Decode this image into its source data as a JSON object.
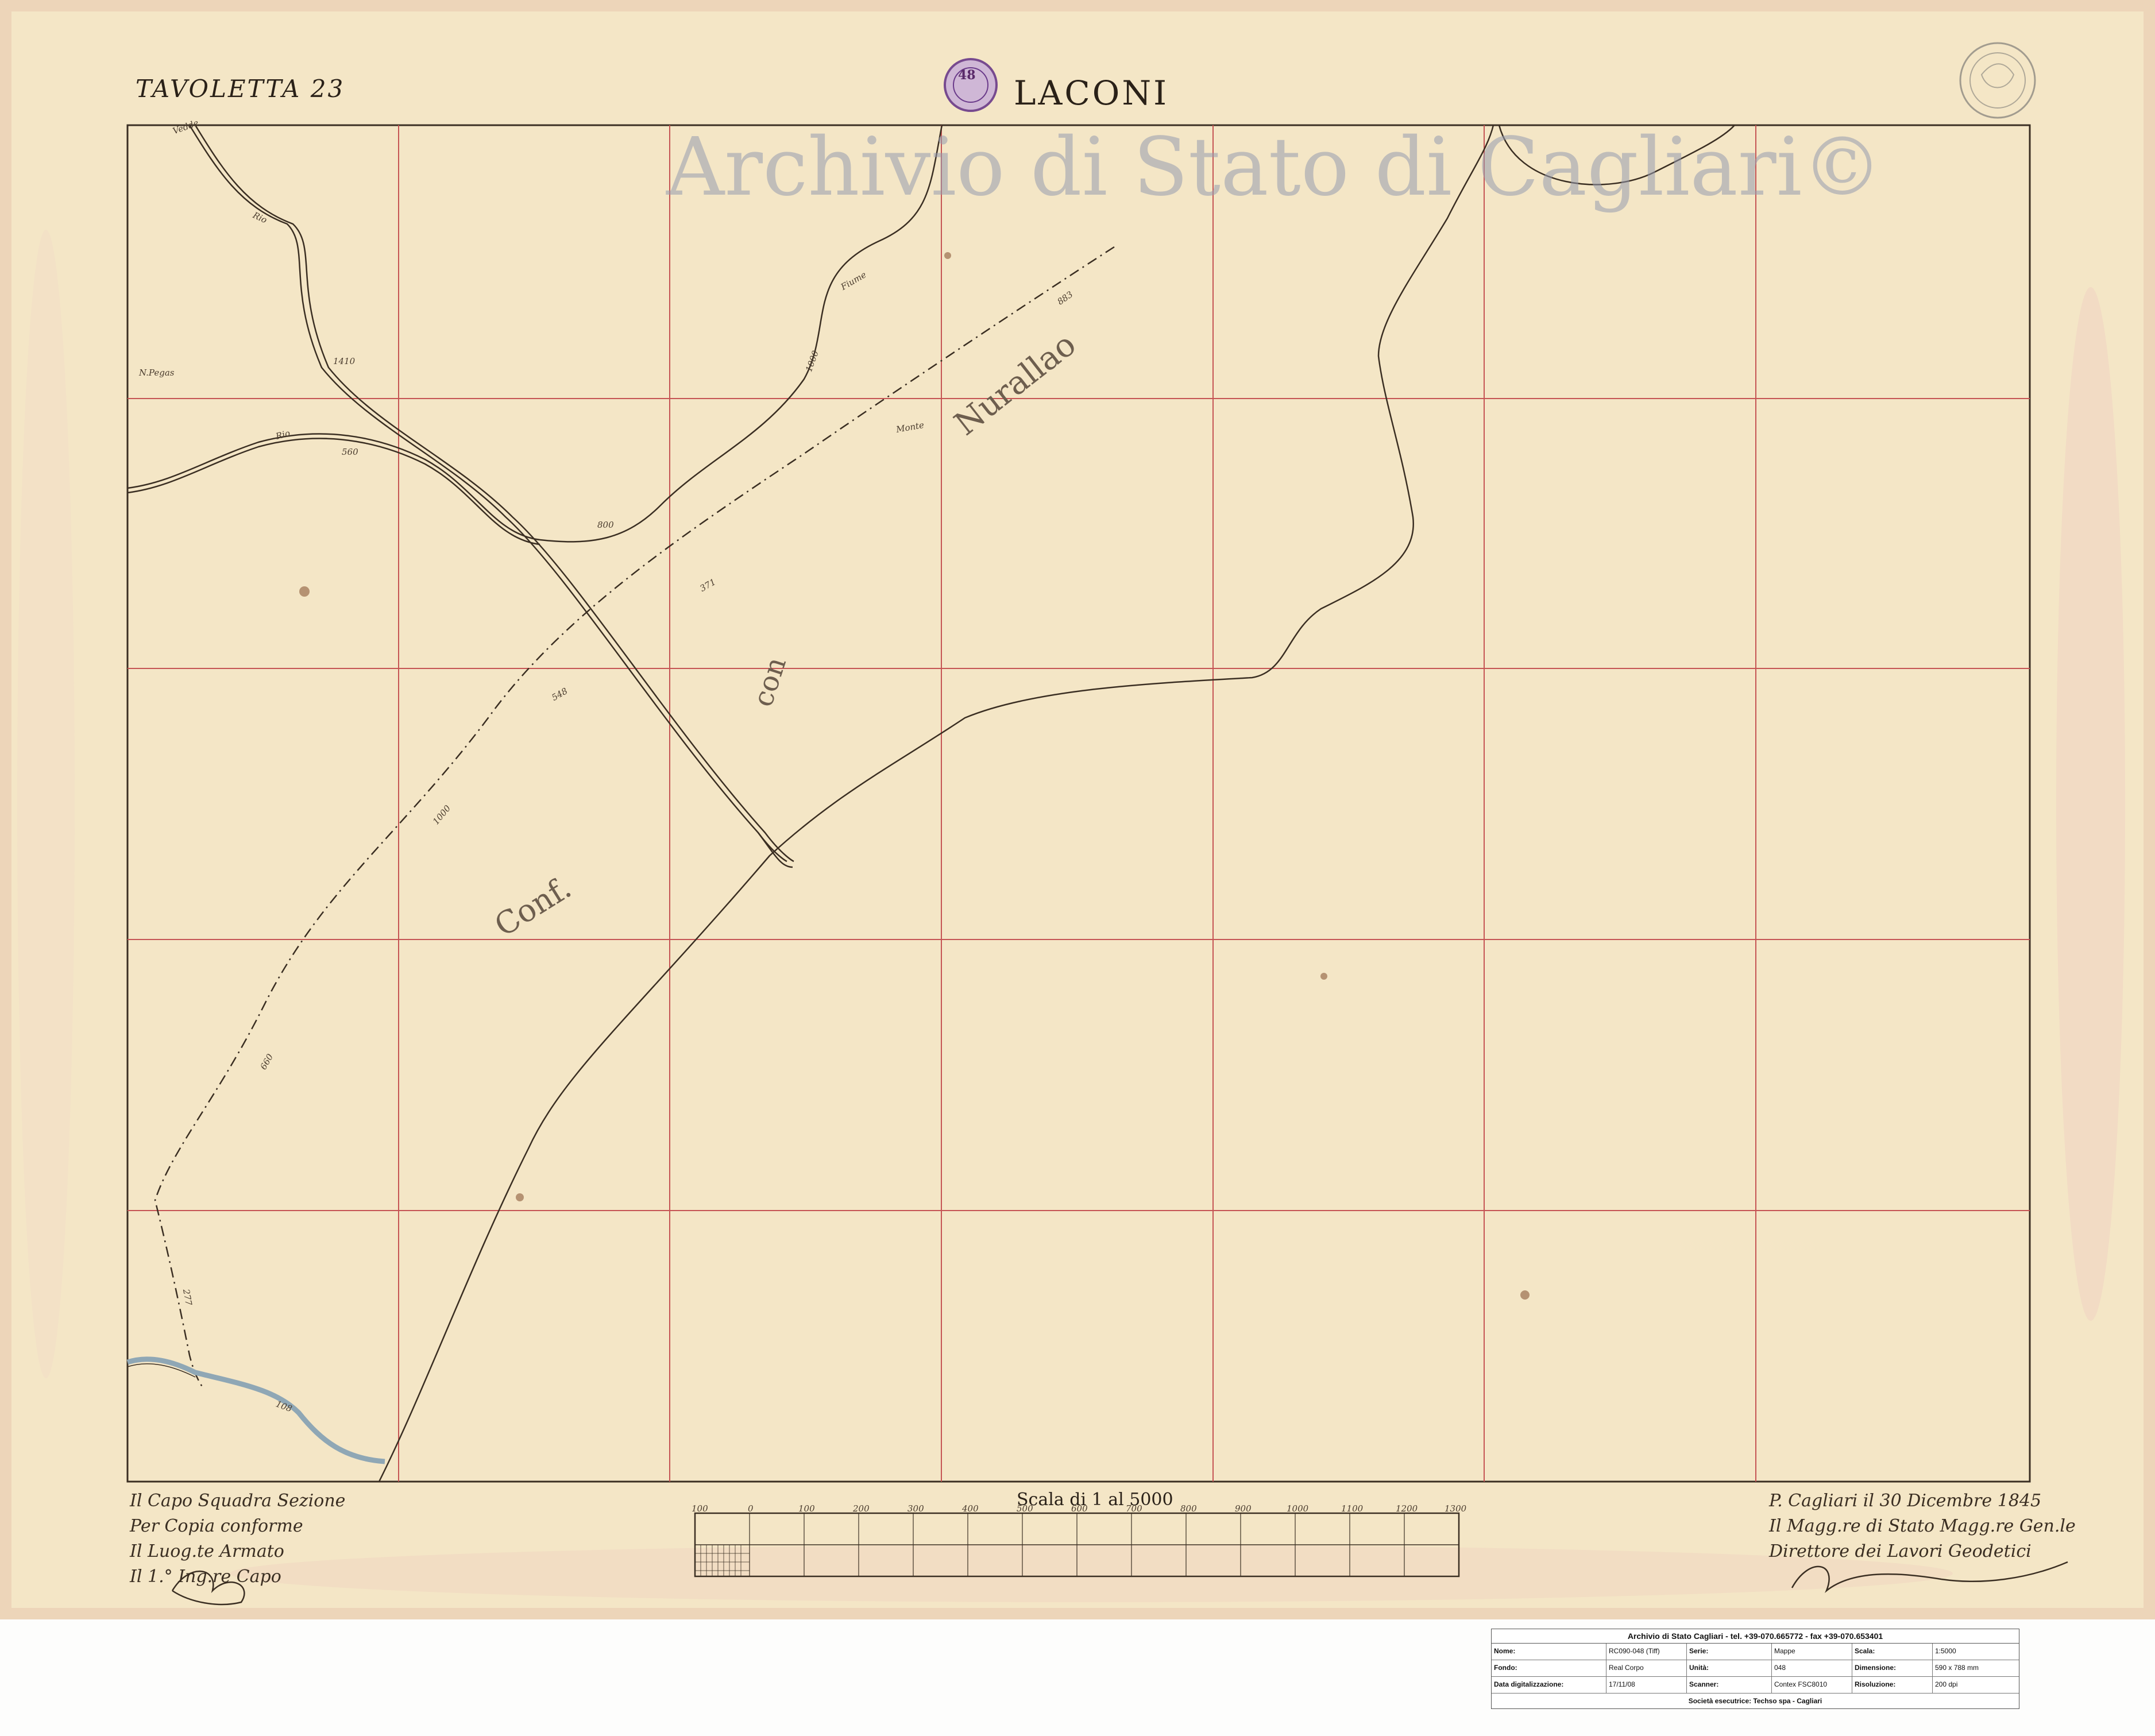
{
  "map": {
    "sheet_label": "TAVOLETTA 23",
    "title": "LACONI",
    "watermark": "Archivio di Stato di Cagliari©",
    "stamp_text": "48",
    "region_labels": [
      "Nurallao",
      "con",
      "Conf."
    ],
    "river_labels": [
      "Vedde",
      "Rio",
      "Fiume"
    ],
    "small_labels": [
      "N.Pegas",
      "Rio",
      "Monte"
    ],
    "elevations": [
      "1410",
      "560",
      "1000",
      "800",
      "883",
      "548",
      "371",
      "1000",
      "660",
      "277",
      "108"
    ],
    "scale_title": "Scala di 1 al 5000",
    "scale_ticks": [
      "100",
      "0",
      "100",
      "200",
      "300",
      "400",
      "500",
      "600",
      "700",
      "800",
      "900",
      "1000",
      "1100",
      "1200",
      "1300"
    ],
    "signature_left": [
      "Il Capo Squadra Sezione",
      "Per Copia conforme",
      "Il Luog.te Armato",
      "Il 1.° Ing.re Capo"
    ],
    "signature_right": [
      "P. Cagliari il 30 Dicembre 1845",
      "Il Magg.re di Stato Magg.re Gen.le",
      "Direttore dei Lavori Geodetici"
    ],
    "colors": {
      "paper": "#f4e6c6",
      "grid": "#c55454",
      "river": "#8fa7b5",
      "ink": "#2a2118",
      "watermark": "#969bae"
    }
  },
  "info_table": {
    "header": "Archivio di Stato Cagliari - tel. +39-070.665772 - fax +39-070.653401",
    "rows": [
      [
        "Nome:",
        "RC090-048 (Tiff)",
        "Serie:",
        "Mappe",
        "Scala:",
        "1:5000"
      ],
      [
        "Fondo:",
        "Real Corpo",
        "Unità:",
        "048",
        "Dimensione:",
        "590 x 788 mm"
      ],
      [
        "Data digitalizzazione:",
        "17/11/08",
        "Scanner:",
        "Contex FSC8010",
        "Risoluzione:",
        "200 dpi"
      ]
    ],
    "footer": "Società esecutrice: Techso spa - Cagliari"
  }
}
